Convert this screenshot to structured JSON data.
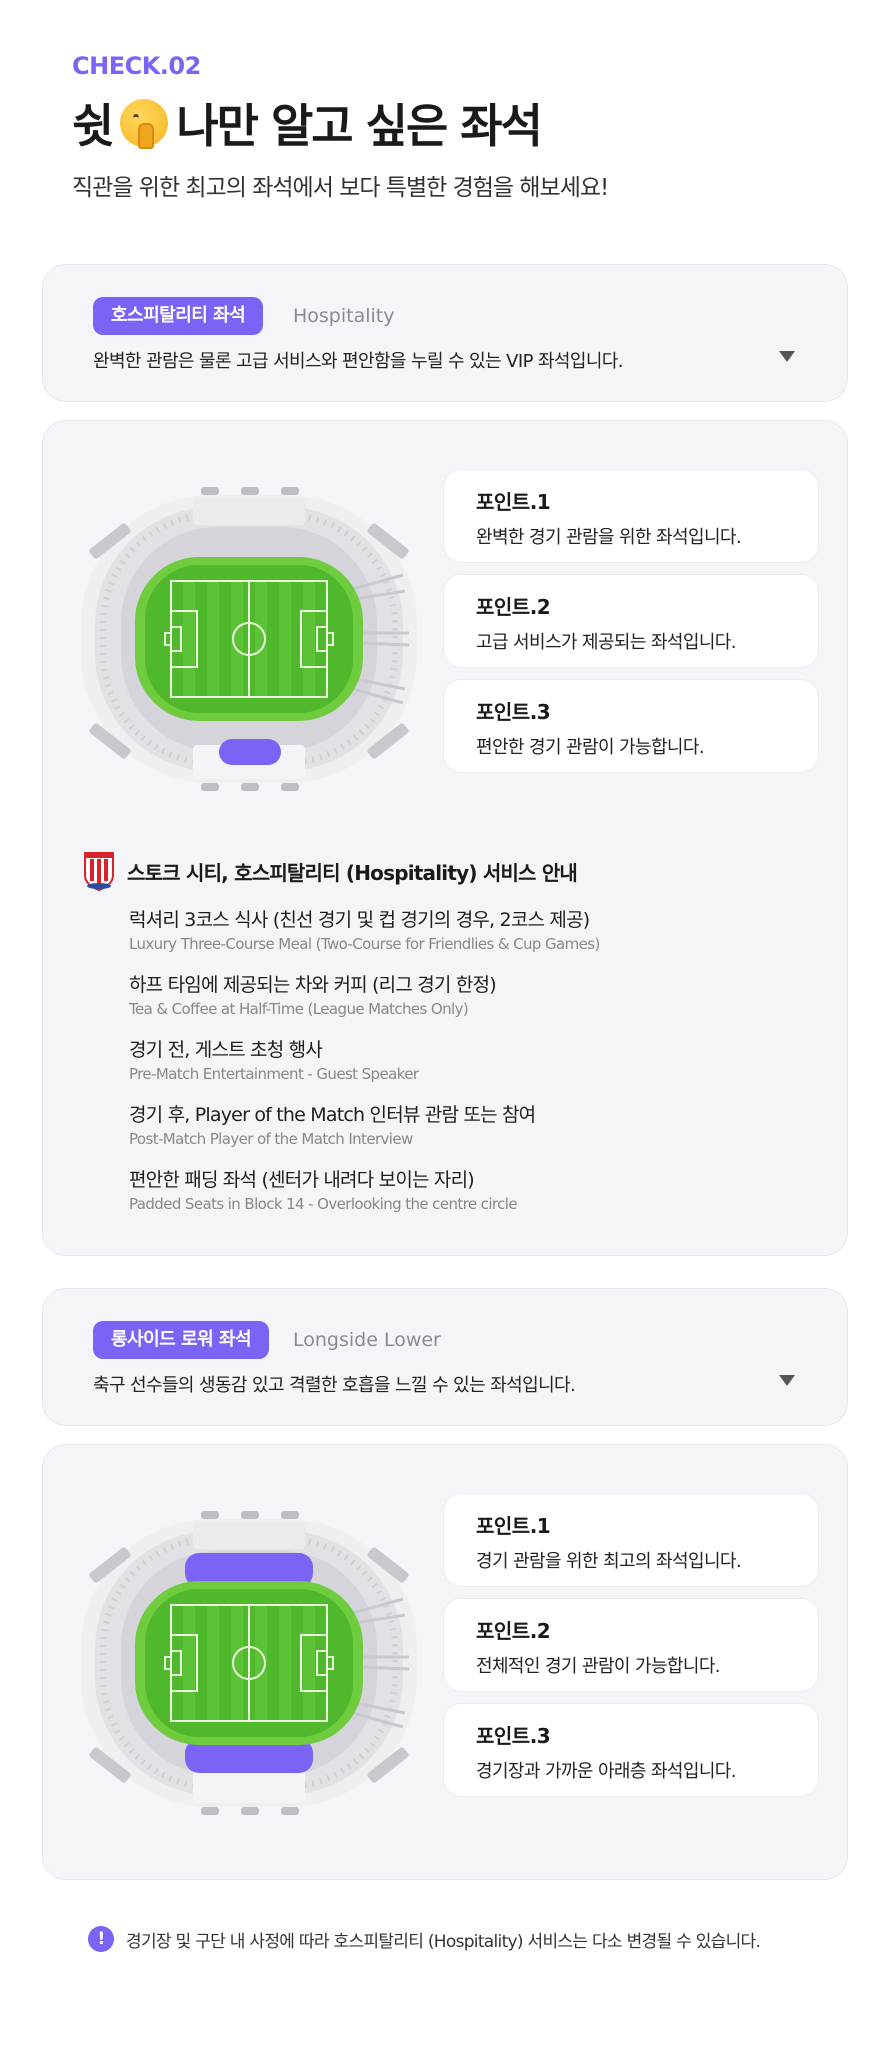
{
  "header": {
    "check_label": "CHECK.02",
    "title_before": "쉿",
    "emoji": "shushing-face-icon",
    "title_after": "나만 알고 싶은 좌석",
    "subtitle": "직관을 위한 최고의 좌석에서 보다 특별한 경험을 해보세요!"
  },
  "colors": {
    "accent": "#7a63f5",
    "pitch": "#4fb82c",
    "panel": "#f5f5f9"
  },
  "sections": [
    {
      "badge": "호스피탈리티 좌석",
      "english": "Hospitality",
      "description": "완벽한 관람은 물론 고급 서비스와 편안함을 누릴 수 있는 VIP 좌석입니다.",
      "expanded": true,
      "highlight": "south-box",
      "points": [
        {
          "title": "포인트.1",
          "desc": "완벽한 경기 관람을 위한 좌석입니다."
        },
        {
          "title": "포인트.2",
          "desc": "고급 서비스가 제공되는 좌석입니다."
        },
        {
          "title": "포인트.3",
          "desc": "편안한 경기 관람이 가능합니다."
        }
      ],
      "service": {
        "title": "스토크 시티, 호스피탈리티 (Hospitality) 서비스 안내",
        "crest": "stoke-city-crest-icon",
        "items": [
          {
            "ko": "럭셔리 3코스 식사 (친선 경기 및 컵 경기의 경우, 2코스 제공)",
            "en": "Luxury Three-Course Meal (Two-Course for Friendlies & Cup Games)"
          },
          {
            "ko": "하프 타임에 제공되는 차와 커피 (리그 경기 한정)",
            "en": "Tea & Coffee at Half-Time (League Matches Only)"
          },
          {
            "ko": "경기 전, 게스트 초청 행사",
            "en": "Pre-Match Entertainment - Guest Speaker"
          },
          {
            "ko": "경기 후, Player of the Match 인터뷰 관람 또는 참여",
            "en": "Post-Match Player of the Match Interview"
          },
          {
            "ko": "편안한 패딩 좌석 (센터가 내려다 보이는 자리)",
            "en": "Padded Seats in Block 14 - Overlooking the centre circle"
          }
        ]
      }
    },
    {
      "badge": "롱사이드 로워 좌석",
      "english": "Longside Lower",
      "description": "축구 선수들의 생동감 있고 격렬한 호흡을 느낄 수 있는 좌석입니다.",
      "expanded": true,
      "highlight": "both-longsides",
      "points": [
        {
          "title": "포인트.1",
          "desc": "경기 관람을 위한 최고의 좌석입니다."
        },
        {
          "title": "포인트.2",
          "desc": "전체적인 경기 관람이 가능합니다."
        },
        {
          "title": "포인트.3",
          "desc": "경기장과 가까운 아래층 좌석입니다."
        }
      ]
    }
  ],
  "notice": {
    "icon": "exclamation-icon",
    "text": "경기장 및 구단 내 사정에 따라 호스피탈리티 (Hospitality) 서비스는 다소 변경될 수 있습니다."
  }
}
